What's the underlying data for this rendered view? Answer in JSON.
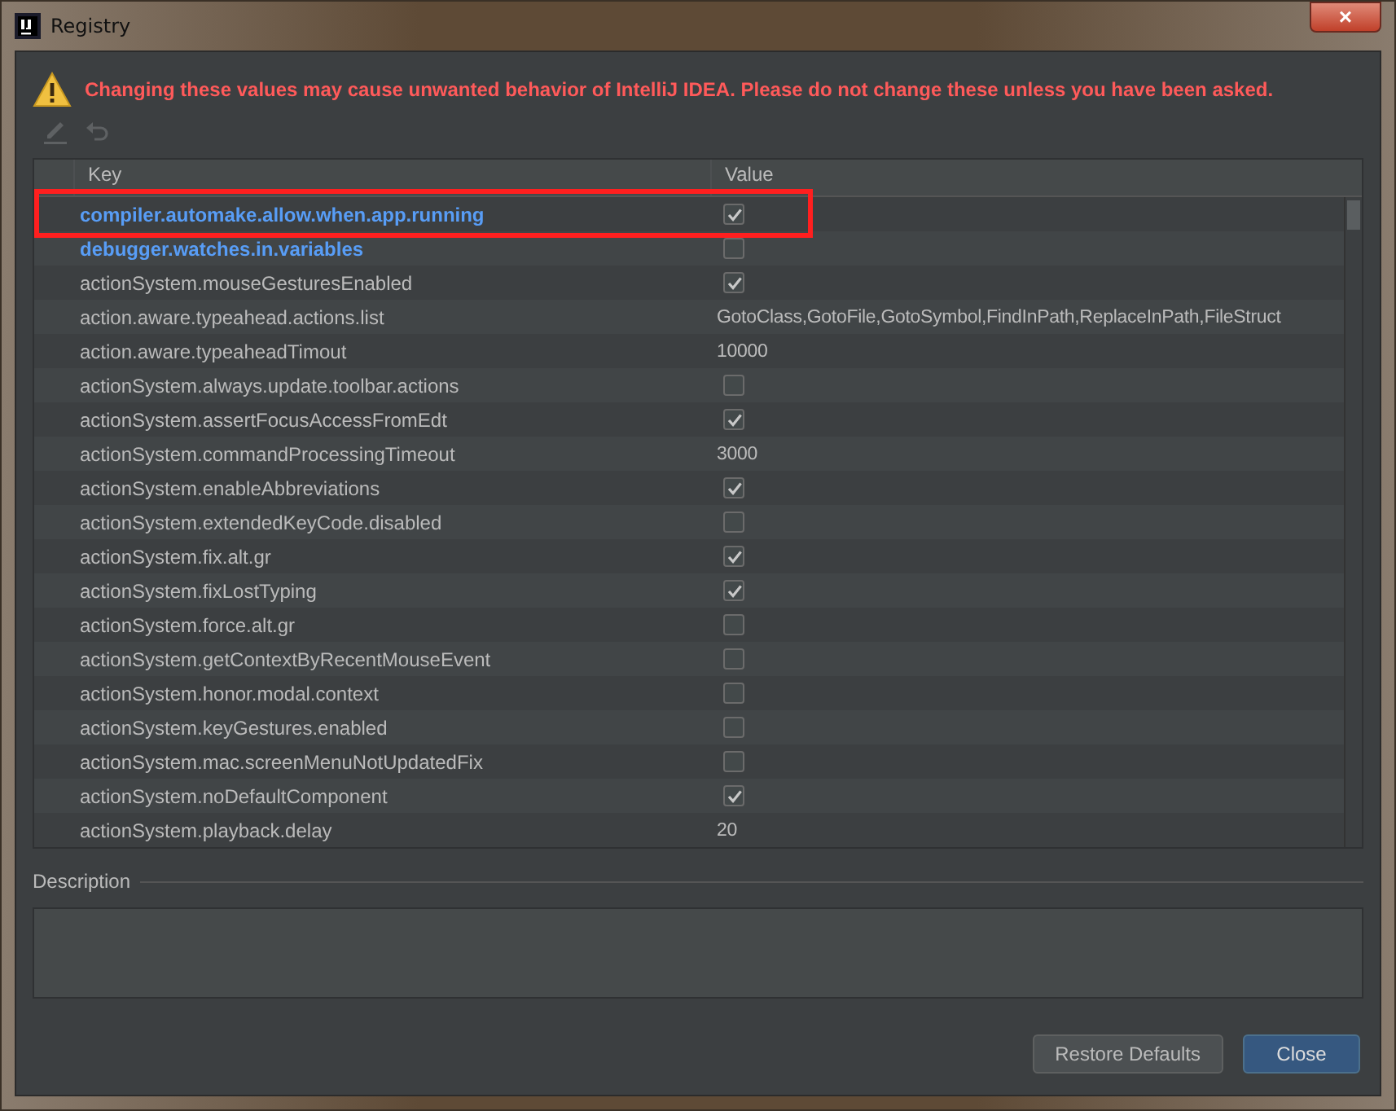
{
  "window": {
    "title": "Registry",
    "close": "×"
  },
  "warning": "Changing these values may cause unwanted behavior of IntelliJ IDEA. Please do not change these unless you have been asked.",
  "toolbar": [
    {
      "kind": "edit",
      "disabled": true
    },
    {
      "kind": "revert",
      "disabled": true
    }
  ],
  "table": {
    "columns": [
      "Key",
      "Value"
    ],
    "rows": [
      {
        "key": "compiler.automake.allow.when.app.running",
        "kind": "checkbox",
        "checked": true,
        "modified": true,
        "highlighted": true
      },
      {
        "key": "debugger.watches.in.variables",
        "kind": "checkbox",
        "checked": false,
        "modified": true,
        "highlighted": false
      },
      {
        "key": "actionSystem.mouseGesturesEnabled",
        "kind": "checkbox",
        "checked": true,
        "modified": false,
        "highlighted": false
      },
      {
        "key": "action.aware.typeahead.actions.list",
        "kind": "text",
        "value": "GotoClass,GotoFile,GotoSymbol,FindInPath,ReplaceInPath,FileStruct",
        "modified": false,
        "highlighted": false
      },
      {
        "key": "action.aware.typeaheadTimout",
        "kind": "text",
        "value": "10000",
        "modified": false,
        "highlighted": false
      },
      {
        "key": "actionSystem.always.update.toolbar.actions",
        "kind": "checkbox",
        "checked": false,
        "modified": false,
        "highlighted": false
      },
      {
        "key": "actionSystem.assertFocusAccessFromEdt",
        "kind": "checkbox",
        "checked": true,
        "modified": false,
        "highlighted": false
      },
      {
        "key": "actionSystem.commandProcessingTimeout",
        "kind": "text",
        "value": "3000",
        "modified": false,
        "highlighted": false
      },
      {
        "key": "actionSystem.enableAbbreviations",
        "kind": "checkbox",
        "checked": true,
        "modified": false,
        "highlighted": false
      },
      {
        "key": "actionSystem.extendedKeyCode.disabled",
        "kind": "checkbox",
        "checked": false,
        "modified": false,
        "highlighted": false
      },
      {
        "key": "actionSystem.fix.alt.gr",
        "kind": "checkbox",
        "checked": true,
        "modified": false,
        "highlighted": false
      },
      {
        "key": "actionSystem.fixLostTyping",
        "kind": "checkbox",
        "checked": true,
        "modified": false,
        "highlighted": false
      },
      {
        "key": "actionSystem.force.alt.gr",
        "kind": "checkbox",
        "checked": false,
        "modified": false,
        "highlighted": false
      },
      {
        "key": "actionSystem.getContextByRecentMouseEvent",
        "kind": "checkbox",
        "checked": false,
        "modified": false,
        "highlighted": false
      },
      {
        "key": "actionSystem.honor.modal.context",
        "kind": "checkbox",
        "checked": false,
        "modified": false,
        "highlighted": false
      },
      {
        "key": "actionSystem.keyGestures.enabled",
        "kind": "checkbox",
        "checked": false,
        "modified": false,
        "highlighted": false
      },
      {
        "key": "actionSystem.mac.screenMenuNotUpdatedFix",
        "kind": "checkbox",
        "checked": false,
        "modified": false,
        "highlighted": false
      },
      {
        "key": "actionSystem.noDefaultComponent",
        "kind": "checkbox",
        "checked": true,
        "modified": false,
        "highlighted": false
      },
      {
        "key": "actionSystem.playback.delay",
        "kind": "text",
        "value": "20",
        "modified": false,
        "highlighted": false
      }
    ]
  },
  "description": {
    "label": "Description"
  },
  "buttons": [
    {
      "label": "Restore Defaults",
      "primary": false
    },
    {
      "label": "Close",
      "primary": true
    }
  ]
}
